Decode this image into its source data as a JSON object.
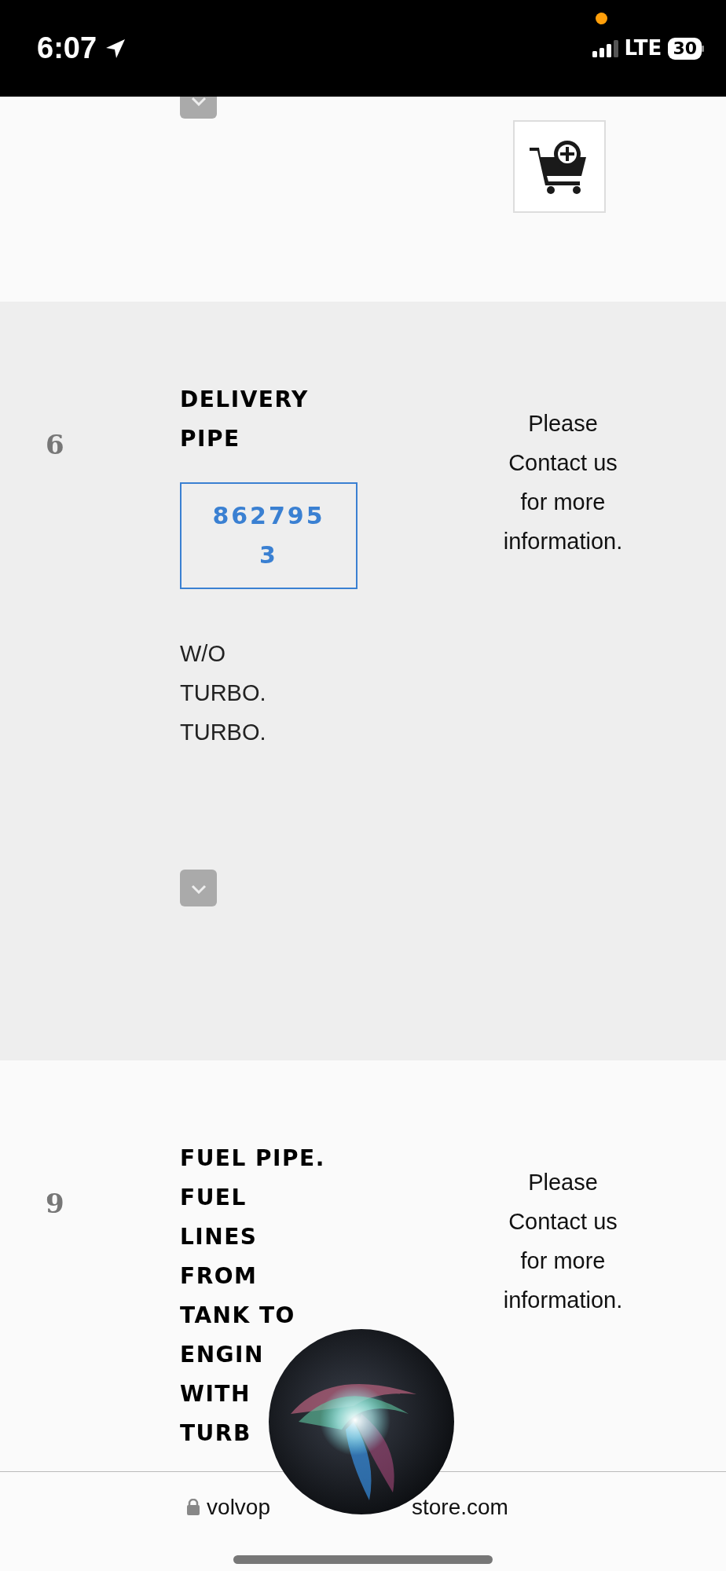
{
  "status_bar": {
    "time": "6:07",
    "network": "LTE",
    "battery": "30"
  },
  "rows": [
    {
      "kind": "cut"
    },
    {
      "kind": "item",
      "number": "6",
      "title_lines": [
        "DELIVERY",
        "PIPE"
      ],
      "part_number": "8627953",
      "description_lines": [
        "W/O",
        "TURBO.",
        "TURBO."
      ],
      "price_note": "Please Contact us for more information.",
      "expand_button": true
    },
    {
      "kind": "item",
      "number": "9",
      "title_lines": [
        "FUEL PIPE.",
        "FUEL",
        "LINES",
        "FROM",
        "TANK TO",
        "ENGIN",
        "WITH",
        "TURB"
      ],
      "price_note": "Please Contact us for more information.",
      "expand_button": false
    }
  ],
  "address_bar": {
    "url_parts": [
      "volvop",
      "store.com"
    ]
  }
}
